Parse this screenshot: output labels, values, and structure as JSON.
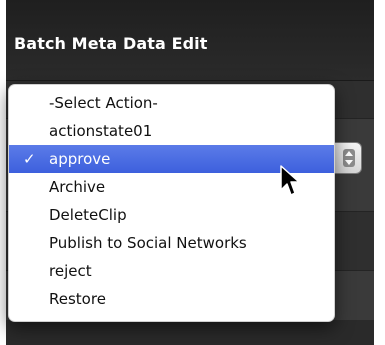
{
  "panel": {
    "title": "Batch Meta Data Edit"
  },
  "action_menu": {
    "selected_index": 2,
    "items": [
      {
        "label": "-Select Action-"
      },
      {
        "label": "actionstate01"
      },
      {
        "label": "approve"
      },
      {
        "label": "Archive"
      },
      {
        "label": "DeleteClip"
      },
      {
        "label": "Publish to Social Networks"
      },
      {
        "label": "reject"
      },
      {
        "label": "Restore"
      }
    ],
    "check_icon": "checkmark-icon"
  },
  "colors": {
    "selection": "#4a6ee0",
    "panel_bg": "#2d2d2d",
    "menu_bg": "#ffffff"
  }
}
